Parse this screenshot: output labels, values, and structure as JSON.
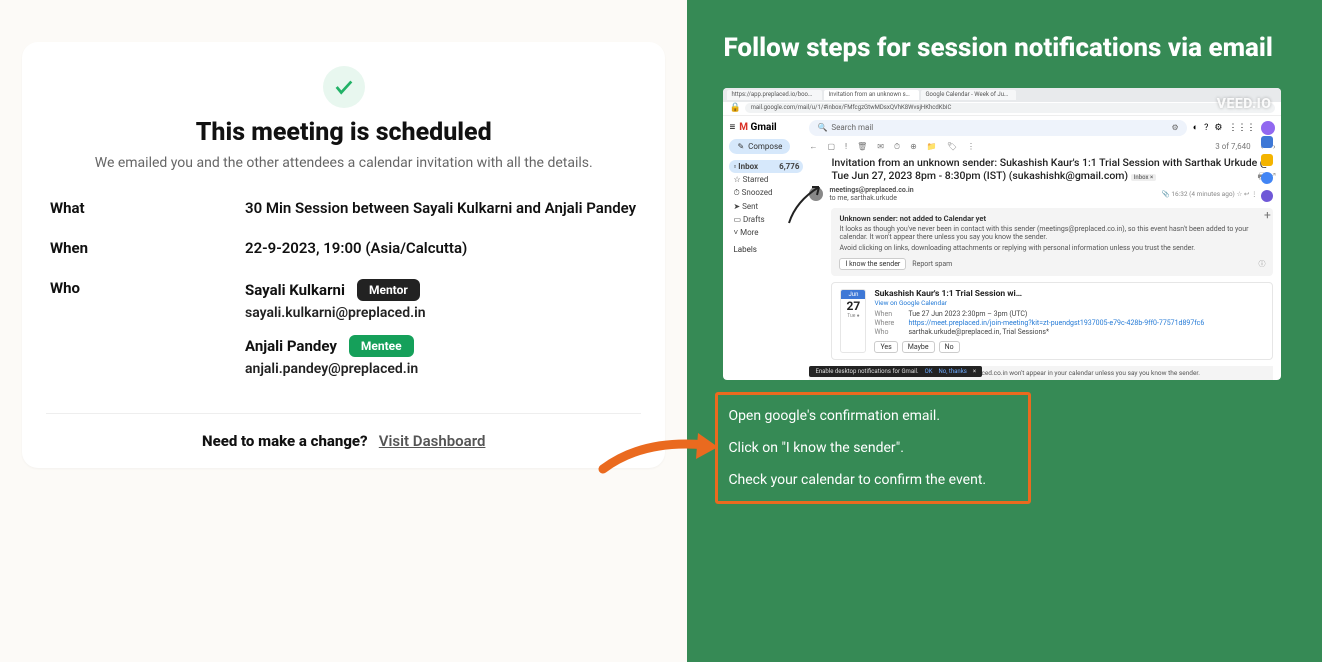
{
  "left": {
    "heading": "This meeting is scheduled",
    "subheading": "We emailed you and the other attendees a calendar invitation with all the details.",
    "labels": {
      "what": "What",
      "when": "When",
      "who": "Who"
    },
    "what": "30 Min Session between Sayali Kulkarni and Anjali Pandey",
    "when": "22-9-2023, 19:00 (Asia/Calcutta)",
    "who": [
      {
        "name": "Sayali Kulkarni",
        "role": "Mentor",
        "role_style": "dark",
        "email": "sayali.kulkarni@preplaced.in"
      },
      {
        "name": "Anjali Pandey",
        "role": "Mentee",
        "role_style": "green",
        "email": "anjali.pandey@preplaced.in"
      }
    ],
    "change_prompt": "Need to make a change?",
    "change_link": "Visit Dashboard"
  },
  "right": {
    "title": "Follow steps for session notifications via email",
    "watermark": "VEED.IO",
    "callout": {
      "line1": "Open google's confirmation email.",
      "line2": "Click on \"I know the sender\".",
      "line3": "Check your calendar to confirm the event."
    }
  },
  "gmail": {
    "tabs": {
      "t1": "https://app.preplaced.io/boo…",
      "t2": "Invitation from an unknown s…",
      "t3": "Google Calendar - Week of Ju…"
    },
    "url": "mail.google.com/mail/u/1/#inbox/FMfcgzGtwMDsxQVhK8WvsjHKhcdKbIC",
    "logo": "Gmail",
    "compose": "Compose",
    "search_placeholder": "Search mail",
    "sidebar": {
      "inbox": "Inbox",
      "inbox_count": "6,776",
      "starred": "Starred",
      "snoozed": "Snoozed",
      "sent": "Sent",
      "drafts": "Drafts",
      "more": "More",
      "labels": "Labels"
    },
    "toolbar_meta": "3 of 7,640",
    "subject": "Invitation from an unknown sender: Sukashish Kaur's 1:1 Trial Session with Sarthak Urkude @ Tue Jun 27, 2023 8pm - 8:30pm (IST) (sukashishk@gmail.com)",
    "external_badge": "Inbox ×",
    "from": "meetings@preplaced.co.in",
    "to": "to me, sarthak.urkude",
    "meta_time": "16:32 (4 minutes ago)",
    "warn": {
      "title": "Unknown sender: not added to Calendar yet",
      "body1": "It looks as though you've never been in contact with this sender (meetings@preplaced.co.in), so this event hasn't been added to your calendar. It won't appear there unless you say you know the sender.",
      "body2": "Avoid clicking on links, downloading attachments or replying with personal information unless you trust the sender.",
      "know": "I know the sender",
      "spam": "Report spam"
    },
    "event": {
      "month": "Jun",
      "day": "27",
      "dow": "Tue",
      "title": "Sukashish Kaur's 1:1 Trial Session wi…",
      "viewcal": "View on Google Calendar",
      "when_lbl": "When",
      "when_val": "Tue 27 Jun 2023 2:30pm – 3pm (UTC)",
      "where_lbl": "Where",
      "where_val": "https://meet.preplaced.in/join-meeting?kit=zt-puendgst1937005-e79c-428b-9ff0-77571d897fc6",
      "who_lbl": "Who",
      "who_val": "sarthak.urkude@preplaced.in, Trial Sessions*",
      "yes": "Yes",
      "maybe": "Maybe",
      "no": "No"
    },
    "notif": {
      "text": "Enable desktop notifications for Gmail.",
      "ok": "OK",
      "no": "No, thanks"
    },
    "bottom": "ings@preplaced.co.in won't appear in your calendar unless you say you know the sender."
  }
}
